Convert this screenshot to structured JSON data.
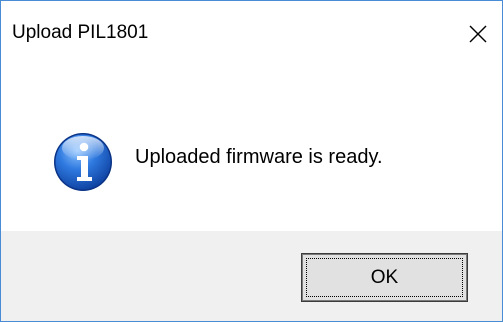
{
  "window": {
    "title": "Upload PIL1801",
    "close_icon": "close-icon",
    "border_color": "#4a8bd6"
  },
  "message": {
    "icon": "info-icon",
    "text": "Uploaded firmware is ready."
  },
  "buttons": {
    "ok_label": "OK"
  },
  "colors": {
    "footer_background": "#f0f0f0",
    "button_background": "#e1e1e1",
    "icon_blue": "#1f5fbf"
  }
}
